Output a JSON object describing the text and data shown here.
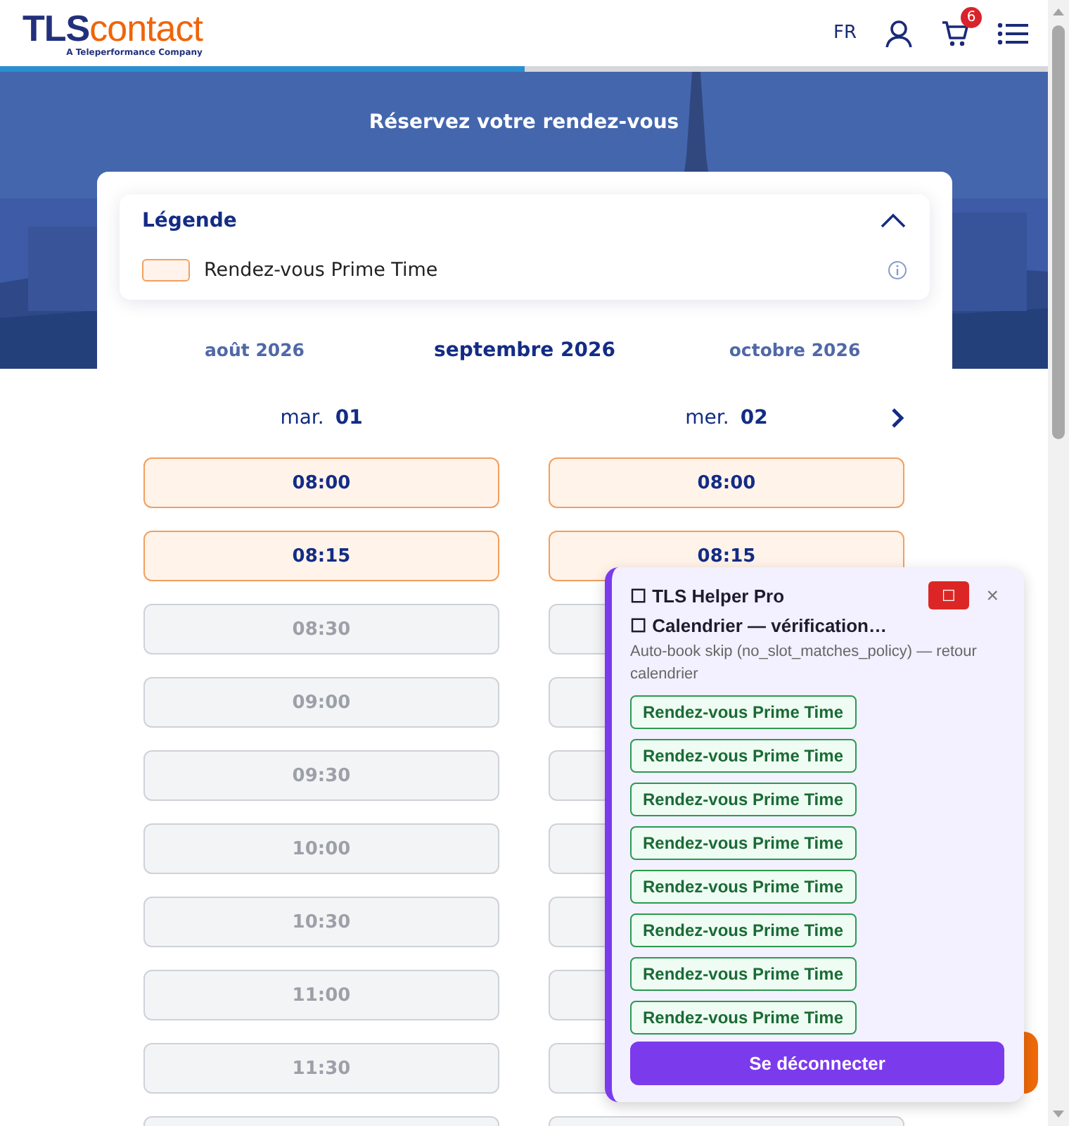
{
  "header": {
    "logo_main": "TLS",
    "logo_accent": "contact",
    "logo_tagline": "A Teleperformance Company",
    "language": "FR",
    "cart_count": "6"
  },
  "progress": {
    "level": 0.5
  },
  "hero": {
    "title": "Réservez votre rendez-vous"
  },
  "legend": {
    "title": "Légende",
    "expanded": true,
    "items": [
      {
        "label": "Rendez-vous Prime Time"
      }
    ]
  },
  "months": [
    {
      "label": "août 2026",
      "selected": false
    },
    {
      "label": "septembre 2026",
      "selected": true
    },
    {
      "label": "octobre 2026",
      "selected": false
    }
  ],
  "days": [
    {
      "weekday": "mar.",
      "date": "01",
      "slots": [
        {
          "time": "08:00",
          "kind": "prime"
        },
        {
          "time": "08:15",
          "kind": "prime"
        },
        {
          "time": "08:30",
          "kind": "unavailable"
        },
        {
          "time": "09:00",
          "kind": "unavailable"
        },
        {
          "time": "09:30",
          "kind": "unavailable"
        },
        {
          "time": "10:00",
          "kind": "unavailable"
        },
        {
          "time": "10:30",
          "kind": "unavailable"
        },
        {
          "time": "11:00",
          "kind": "unavailable"
        },
        {
          "time": "11:30",
          "kind": "unavailable"
        },
        {
          "kind": "unavailable"
        }
      ]
    },
    {
      "weekday": "mer.",
      "date": "02",
      "slots": [
        {
          "time": "08:00",
          "kind": "prime"
        },
        {
          "time": "08:15",
          "kind": "prime"
        },
        {
          "kind": "unavailable"
        },
        {
          "kind": "unavailable"
        },
        {
          "kind": "unavailable"
        },
        {
          "kind": "unavailable"
        },
        {
          "kind": "unavailable"
        },
        {
          "kind": "unavailable"
        },
        {
          "kind": "unavailable"
        },
        {
          "kind": "unavailable"
        }
      ]
    }
  ],
  "helper": {
    "title": "☐ TLS Helper Pro",
    "stop_label": "☐",
    "close_label": "×",
    "status": "☐ Calendrier — vérification…",
    "message": "Auto-book skip (no_slot_matches_policy) — retour calendrier",
    "tags": [
      "Rendez-vous Prime Time",
      "Rendez-vous Prime Time",
      "Rendez-vous Prime Time",
      "Rendez-vous Prime Time",
      "Rendez-vous Prime Time",
      "Rendez-vous Prime Time",
      "Rendez-vous Prime Time",
      "Rendez-vous Prime Time"
    ],
    "logout": "Se déconnecter"
  }
}
